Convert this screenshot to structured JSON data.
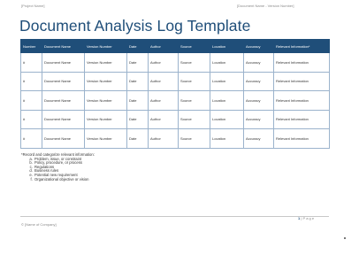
{
  "header": {
    "left": "[Project Name]",
    "right": "[Document Name - Version Number]"
  },
  "title": "Document Analysis Log Template",
  "table": {
    "columns": [
      "Number",
      "Document Name",
      "Version Number",
      "Date",
      "Author",
      "Source",
      "Location",
      "Accuracy",
      "Relevant Information*"
    ],
    "rows": [
      [
        "#",
        "Document Name",
        "Version Number",
        "Date",
        "Author",
        "Source",
        "Location",
        "Accuracy",
        "Relevant Information"
      ],
      [
        "#",
        "Document Name",
        "Version Number",
        "Date",
        "Author",
        "Source",
        "Location",
        "Accuracy",
        "Relevant Information"
      ],
      [
        "#",
        "Document Name",
        "Version Number",
        "Date",
        "Author",
        "Source",
        "Location",
        "Accuracy",
        "Relevant Information"
      ],
      [
        "#",
        "Document Name",
        "Version Number",
        "Date",
        "Author",
        "Source",
        "Location",
        "Accuracy",
        "Relevant Information"
      ],
      [
        "#",
        "Document Name",
        "Version Number",
        "Date",
        "Author",
        "Source",
        "Location",
        "Accuracy",
        "Relevant Information"
      ]
    ]
  },
  "notes": {
    "intro": "*Record and categorize relevant information:",
    "items": [
      "Problem, issue, or constraint",
      "Policy, procedure, or process",
      "Regulations",
      "Business rules",
      "Potential new requirement",
      "Organizational objective or vision"
    ]
  },
  "footer": {
    "page_number": "1",
    "page_label": "| P a g e",
    "company": "© [Name of Company]"
  },
  "colors": {
    "accent": "#1f4e79",
    "header_text": "#ffffff",
    "grid": "#9bb3cc"
  }
}
